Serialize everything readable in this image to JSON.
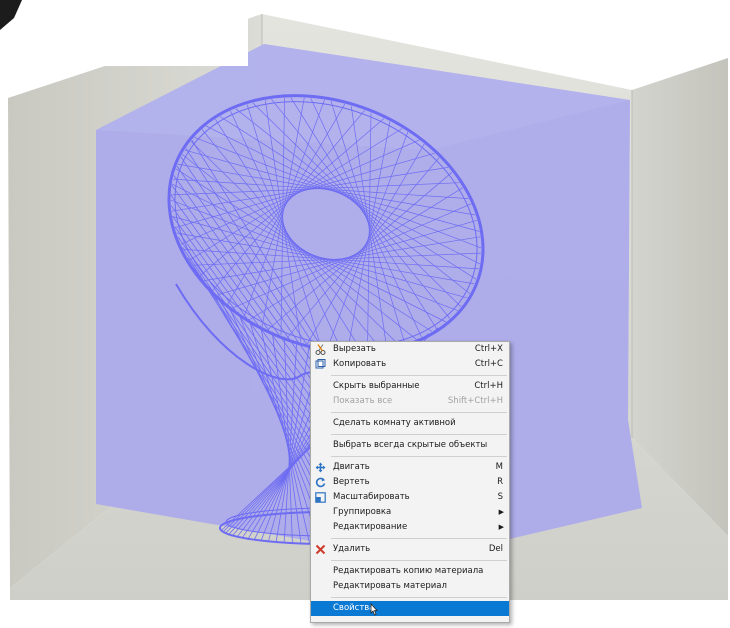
{
  "context_menu": {
    "items": [
      {
        "label": "Вырезать",
        "shortcut": "Ctrl+X",
        "icon": "scissors-icon"
      },
      {
        "label": "Копировать",
        "shortcut": "Ctrl+C",
        "icon": "copy-icon"
      },
      {
        "label": "Скрыть выбранные",
        "shortcut": "Ctrl+H"
      },
      {
        "label": "Показать все",
        "shortcut": "Shift+Ctrl+H",
        "disabled": true
      },
      {
        "label": "Сделать комнату активной"
      },
      {
        "label": "Выбрать всегда скрытые объекты"
      },
      {
        "label": "Двигать",
        "shortcut": "M",
        "icon": "move-icon"
      },
      {
        "label": "Вертеть",
        "shortcut": "R",
        "icon": "rotate-icon"
      },
      {
        "label": "Масштабировать",
        "shortcut": "S",
        "icon": "scale-icon"
      },
      {
        "label": "Группировка",
        "submenu": true
      },
      {
        "label": "Редактирование",
        "submenu": true
      },
      {
        "label": "Удалить",
        "shortcut": "Del",
        "icon": "delete-icon"
      },
      {
        "label": "Редактировать копию материала"
      },
      {
        "label": "Редактировать материал"
      },
      {
        "label": "Свойства",
        "highlighted": true
      }
    ]
  },
  "colors": {
    "selection_blue": "#0a79d4",
    "wireframe": "#6e6cf2",
    "box_overlay": "#a9a8ea",
    "room_wall": "#d9d9d3",
    "delete_red": "#cf3b2a"
  }
}
